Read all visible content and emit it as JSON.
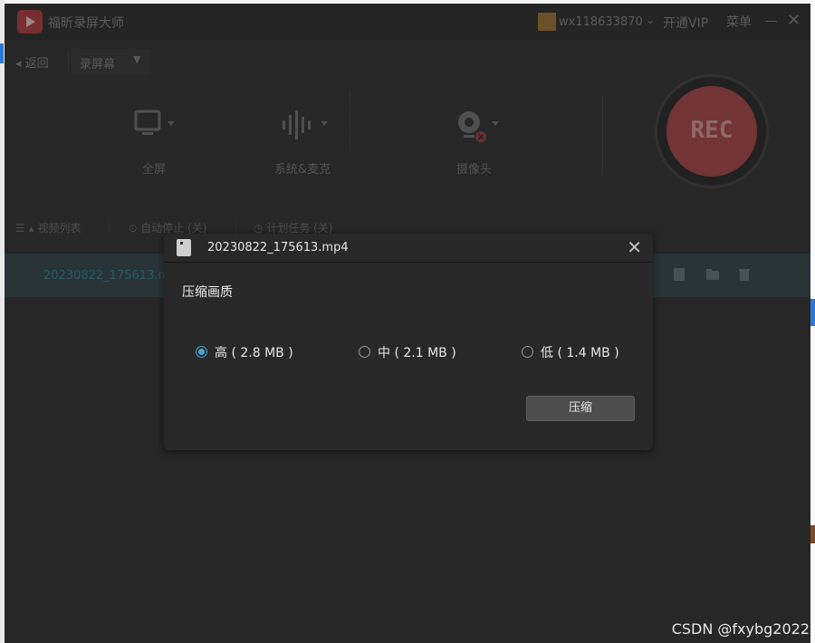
{
  "app": {
    "title": "福昕录屏大师",
    "username": "wx118633870",
    "vip_label": "开通VIP",
    "menu_label": "菜单"
  },
  "toolbar": {
    "back_label": "返回",
    "mode_label": "录屏幕"
  },
  "tools": {
    "fullscreen": "全屏",
    "audio": "系统&麦克",
    "camera": "摄像头"
  },
  "rec": {
    "label": "REC"
  },
  "tabs": {
    "video_list": "视频列表",
    "auto_stop": "自动停止 (关)",
    "scheduled": "计划任务 (关)"
  },
  "file_row": {
    "name": "20230822_175613.mp4"
  },
  "dialog": {
    "title": "20230822_175613.mp4",
    "quality_label": "压缩画质",
    "options": [
      {
        "label": "高 ( 2.8 MB )",
        "selected": true
      },
      {
        "label": "中 ( 2.1 MB )",
        "selected": false
      },
      {
        "label": "低 ( 1.4 MB )",
        "selected": false
      }
    ],
    "compress_button": "压缩"
  },
  "watermark": "CSDN @fxybg2022"
}
